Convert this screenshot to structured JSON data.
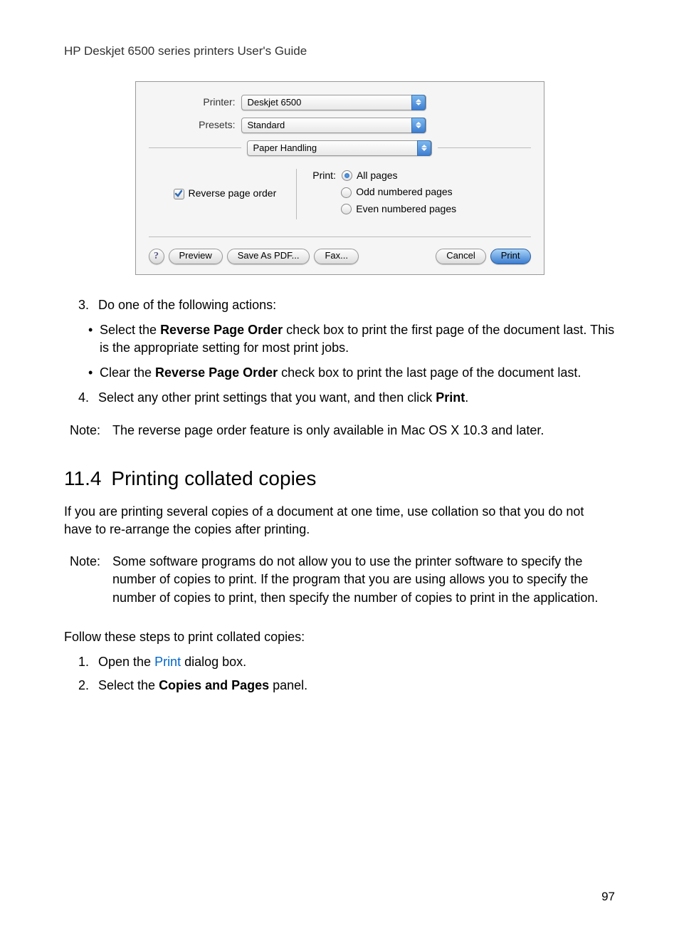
{
  "header": "HP Deskjet 6500 series printers User's Guide",
  "dialog": {
    "printer_label": "Printer:",
    "printer_value": "Deskjet 6500",
    "presets_label": "Presets:",
    "presets_value": "Standard",
    "pane_value": "Paper Handling",
    "reverse_checkbox": "Reverse page order",
    "print_label": "Print:",
    "radio_all": "All pages",
    "radio_odd": "Odd numbered pages",
    "radio_even": "Even numbered pages",
    "help": "?",
    "preview": "Preview",
    "save_pdf": "Save As PDF...",
    "fax": "Fax...",
    "cancel": "Cancel",
    "print_btn": "Print"
  },
  "step3": {
    "num": "3.",
    "text": "Do one of the following actions:",
    "bullet1_pre": "Select the ",
    "bullet1_bold": "Reverse Page Order",
    "bullet1_post": " check box to print the first page of the document last. This is the appropriate setting for most print jobs.",
    "bullet2_pre": "Clear the ",
    "bullet2_bold": "Reverse Page Order",
    "bullet2_post": " check box to print the last page of the document last."
  },
  "step4": {
    "num": "4.",
    "pre": "Select any other print settings that you want, and then click ",
    "bold": "Print",
    "post": "."
  },
  "note1": {
    "label": "Note:",
    "text": "The reverse page order feature is only available in Mac OS X 10.3 and later."
  },
  "section": {
    "num": "11.4",
    "title": "Printing collated copies"
  },
  "intro": "If you are printing several copies of a document at one time, use collation so that you do not have to re-arrange the copies after printing.",
  "note2": {
    "label": "Note:",
    "text": "Some software programs do not allow you to use the printer software to specify the number of copies to print. If the program that you are using allows you to specify the number of copies to print, then specify the number of copies to print in the application."
  },
  "follow": "Follow these steps to print collated copies:",
  "step_c1": {
    "num": "1.",
    "pre": "Open the ",
    "link": "Print",
    "post": " dialog box."
  },
  "step_c2": {
    "num": "2.",
    "pre": "Select the ",
    "bold": "Copies and Pages",
    "post": " panel."
  },
  "page_number": "97"
}
